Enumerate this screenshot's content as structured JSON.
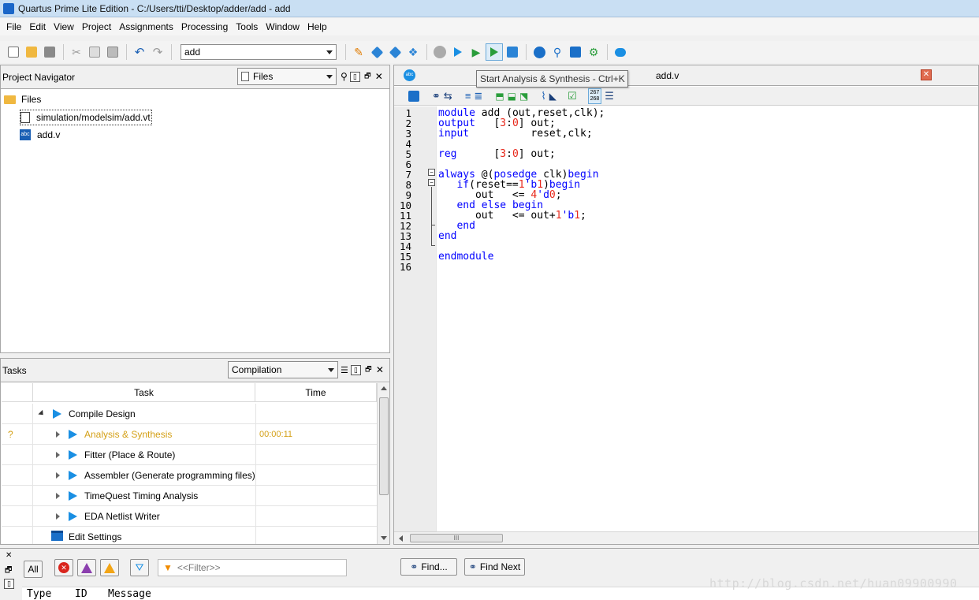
{
  "window": {
    "title": "Quartus Prime Lite Edition - C:/Users/tti/Desktop/adder/add - add"
  },
  "menu": [
    "File",
    "Edit",
    "View",
    "Project",
    "Assignments",
    "Processing",
    "Tools",
    "Window",
    "Help"
  ],
  "toolbar": {
    "project_combo": "add"
  },
  "project_navigator": {
    "title": "Project Navigator",
    "view_combo": "Files",
    "folder_label": "Files",
    "files": [
      "simulation/modelsim/add.vt",
      "add.v"
    ]
  },
  "tasks": {
    "title": "Tasks",
    "flow_combo": "Compilation",
    "col_task": "Task",
    "col_time": "Time",
    "rows": [
      {
        "label": "Compile Design",
        "time": "",
        "status": ""
      },
      {
        "label": "Analysis & Synthesis",
        "time": "00:00:11",
        "status": "?"
      },
      {
        "label": "Fitter (Place & Route)",
        "time": "",
        "status": ""
      },
      {
        "label": "Assembler (Generate programming files)",
        "time": "",
        "status": ""
      },
      {
        "label": "TimeQuest Timing Analysis",
        "time": "",
        "status": ""
      },
      {
        "label": "EDA Netlist Writer",
        "time": "",
        "status": ""
      },
      {
        "label": "Edit Settings",
        "time": "",
        "status": ""
      }
    ]
  },
  "editor": {
    "tab_label": "add.v",
    "tooltip": "Start Analysis & Synthesis - Ctrl+K",
    "line_numbers": [
      "1",
      "2",
      "3",
      "4",
      "5",
      "6",
      "7",
      "8",
      "9",
      "10",
      "11",
      "12",
      "13",
      "14",
      "15",
      "16"
    ],
    "code_lines": [
      "module add (out,reset,clk);",
      "output   [3:0] out;",
      "input          reset,clk;",
      "",
      "reg      [3:0] out;",
      "",
      "always @(posedge clk)begin",
      "   if(reset==1'b1)begin",
      "      out   <= 4'd0;",
      "   end else begin",
      "      out   <= out+1'b1;",
      "   end",
      "end",
      "",
      "endmodule",
      ""
    ],
    "hscroll_grip": "III",
    "toolbar_counter_top": "267",
    "toolbar_counter_bottom": "268"
  },
  "messages": {
    "all_button": "All",
    "filter_placeholder": "<<Filter>>",
    "find_button": "Find...",
    "find_next_button": "Find Next",
    "columns": [
      "Type",
      "ID",
      "Message"
    ]
  },
  "watermark": "http://blog.csdn.net/huan09900990",
  "colors": {
    "keyword": "#0000ff",
    "number": "#e8291c",
    "warning_text": "#d4a017",
    "play": "#1a8fe3"
  }
}
